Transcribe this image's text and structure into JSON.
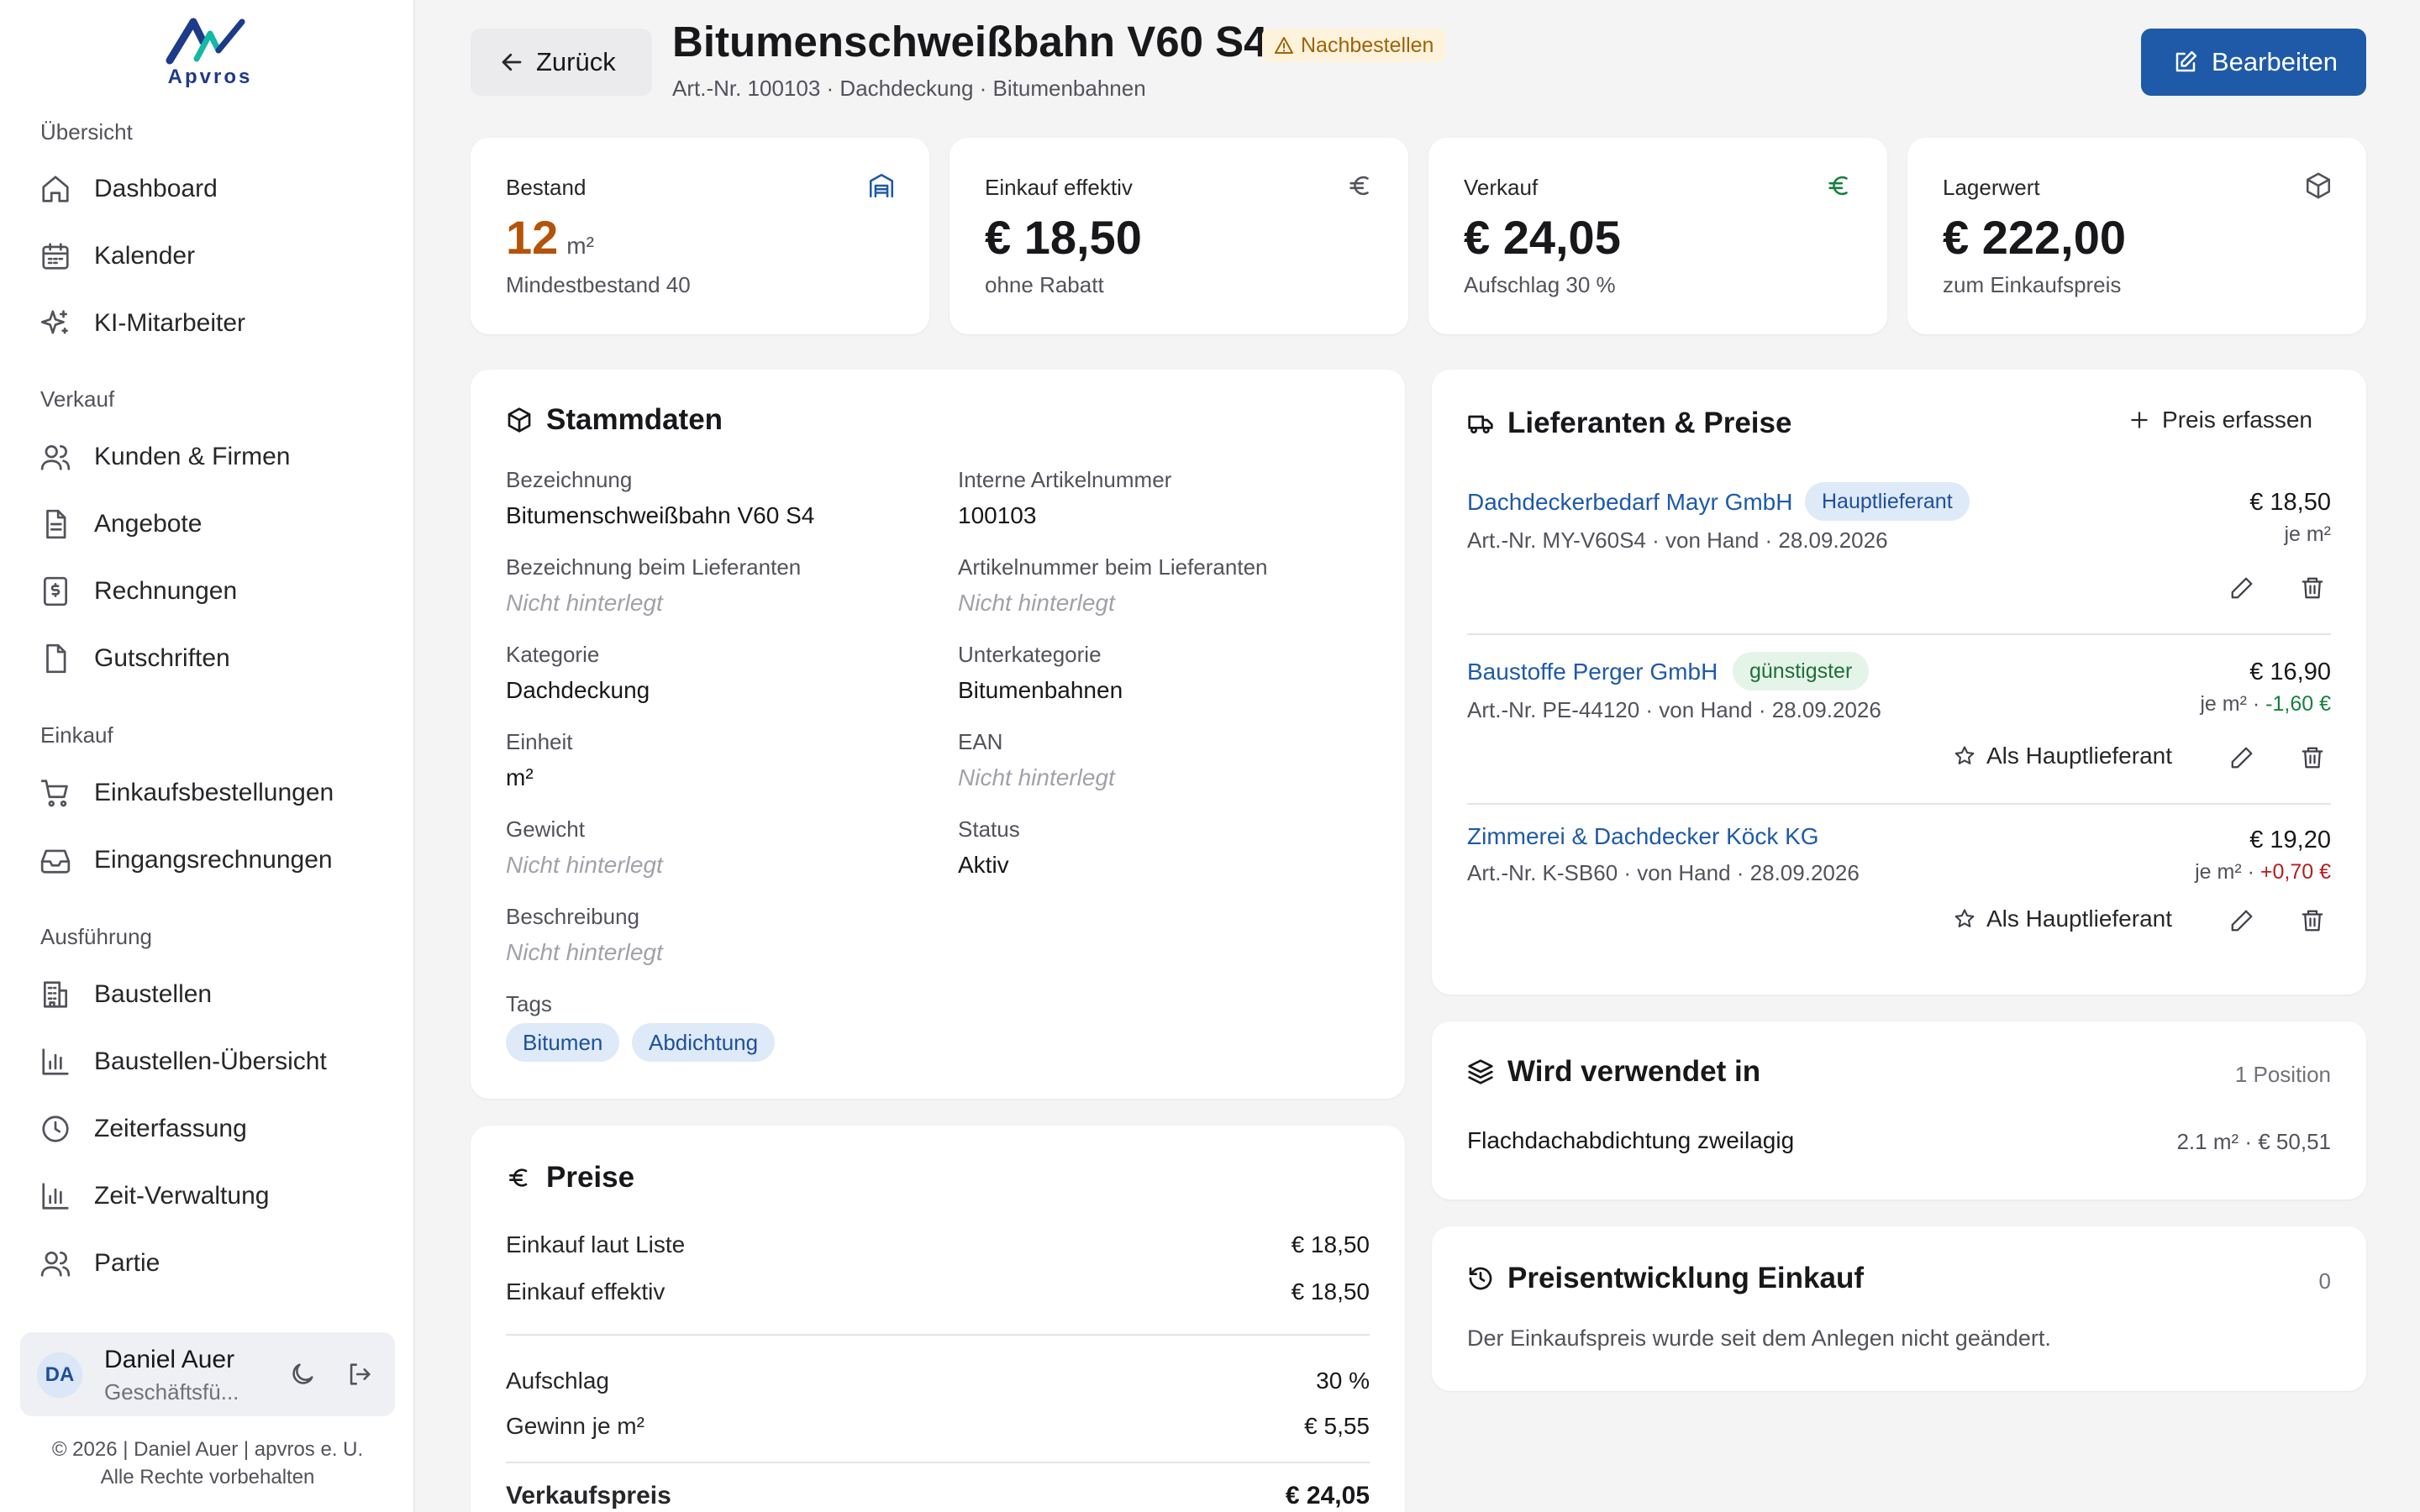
{
  "brand": {
    "logo_text": "Apvros",
    "accent": "#1e5aa8",
    "logo_colors": [
      "#1e3a8a",
      "#14b8a6"
    ]
  },
  "sidebar": {
    "groups": [
      {
        "label": "Übersicht",
        "items": [
          {
            "label": "Dashboard",
            "icon": "home-icon"
          },
          {
            "label": "Kalender",
            "icon": "calendar-icon"
          },
          {
            "label": "KI-Mitarbeiter",
            "icon": "sparkles-icon"
          }
        ]
      },
      {
        "label": "Verkauf",
        "items": [
          {
            "label": "Kunden & Firmen",
            "icon": "users-icon"
          },
          {
            "label": "Angebote",
            "icon": "document-icon"
          },
          {
            "label": "Rechnungen",
            "icon": "invoice-icon"
          },
          {
            "label": "Gutschriften",
            "icon": "file-icon"
          }
        ]
      },
      {
        "label": "Einkauf",
        "items": [
          {
            "label": "Einkaufsbestellungen",
            "icon": "cart-icon"
          },
          {
            "label": "Eingangsrechnungen",
            "icon": "inbox-icon"
          }
        ]
      },
      {
        "label": "Ausführung",
        "items": [
          {
            "label": "Baustellen",
            "icon": "building-icon"
          },
          {
            "label": "Baustellen-Übersicht",
            "icon": "bar-chart-icon"
          },
          {
            "label": "Zeiterfassung",
            "icon": "clock-icon"
          },
          {
            "label": "Zeit-Verwaltung",
            "icon": "bar-chart-icon"
          },
          {
            "label": "Partie",
            "icon": "users-icon"
          }
        ]
      }
    ],
    "user": {
      "initials": "DA",
      "name": "Daniel Auer",
      "role": "Geschäftsfü..."
    },
    "footer": {
      "line1": "© 2026 | Daniel Auer | apvros e. U.",
      "line2": "Alle Rechte vorbehalten"
    }
  },
  "header": {
    "back_label": "Zurück",
    "title": "Bitumenschweißbahn V60 S4",
    "status_badge": "Nachbestellen",
    "subtitle": "Art.-Nr. 100103 · Dachdeckung · Bitumenbahnen",
    "edit_label": "Bearbeiten"
  },
  "stats": [
    {
      "label": "Bestand",
      "value": "12",
      "unit": "m²",
      "sub": "Mindestbestand 40",
      "icon": "warehouse-icon",
      "value_color": "#b45309",
      "icon_color": "#1e5aa8"
    },
    {
      "label": "Einkauf effektiv",
      "value": "€ 18,50",
      "unit": "",
      "sub": "ohne Rabatt",
      "icon": "euro-icon",
      "value_color": "#18181b",
      "icon_color": "#52525b"
    },
    {
      "label": "Verkauf",
      "value": "€ 24,05",
      "unit": "",
      "sub": "Aufschlag 30 %",
      "icon": "euro-icon",
      "value_color": "#18181b",
      "icon_color": "#15803d"
    },
    {
      "label": "Lagerwert",
      "value": "€ 222,00",
      "unit": "",
      "sub": "zum Einkaufspreis",
      "icon": "box-icon",
      "value_color": "#18181b",
      "icon_color": "#52525b"
    }
  ],
  "stammdaten": {
    "title": "Stammdaten",
    "fields": [
      {
        "label": "Bezeichnung",
        "value": "Bitumenschweißbahn V60 S4",
        "empty": false
      },
      {
        "label": "Interne Artikelnummer",
        "value": "100103",
        "empty": false
      },
      {
        "label": "Bezeichnung beim Lieferanten",
        "value": "Nicht hinterlegt",
        "empty": true
      },
      {
        "label": "Artikelnummer beim Lieferanten",
        "value": "Nicht hinterlegt",
        "empty": true
      },
      {
        "label": "Kategorie",
        "value": "Dachdeckung",
        "empty": false
      },
      {
        "label": "Unterkategorie",
        "value": "Bitumenbahnen",
        "empty": false
      },
      {
        "label": "Einheit",
        "value": "m²",
        "empty": false
      },
      {
        "label": "EAN",
        "value": "Nicht hinterlegt",
        "empty": true
      },
      {
        "label": "Gewicht",
        "value": "Nicht hinterlegt",
        "empty": true
      },
      {
        "label": "Status",
        "value": "Aktiv",
        "empty": false
      },
      {
        "label": "Beschreibung",
        "value": "Nicht hinterlegt",
        "empty": true
      }
    ],
    "tags_label": "Tags",
    "tags": [
      "Bitumen",
      "Abdichtung"
    ]
  },
  "preise": {
    "title": "Preise",
    "rows": [
      {
        "label": "Einkauf laut Liste",
        "value": "€ 18,50"
      },
      {
        "label": "Einkauf effektiv",
        "value": "€ 18,50"
      },
      {
        "label": "Aufschlag",
        "value": "30 %"
      },
      {
        "label": "Gewinn je m²",
        "value": "€ 5,55"
      },
      {
        "label": "Verkaufspreis",
        "value": "€ 24,05"
      }
    ]
  },
  "lieferanten": {
    "title": "Lieferanten & Preise",
    "add_label": "Preis erfassen",
    "main_supplier_label": "Als Hauptlieferant",
    "items": [
      {
        "name": "Dachdeckerbedarf Mayr GmbH",
        "badge": "Hauptlieferant",
        "meta": "Art.-Nr. MY-V60S4 · von Hand · 28.09.2026",
        "price": "€ 18,50",
        "unit": "je m²",
        "delta": ""
      },
      {
        "name": "Baustoffe Perger GmbH",
        "badge": "günstigster",
        "meta": "Art.-Nr. PE-44120 · von Hand · 28.09.2026",
        "price": "€ 16,90",
        "unit": "je m² ·",
        "delta": "-1,60 €"
      },
      {
        "name": "Zimmerei & Dachdecker Köck KG",
        "badge": "",
        "meta": "Art.-Nr. K-SB60 · von Hand · 28.09.2026",
        "price": "€ 19,20",
        "unit": "je m² ·",
        "delta": "+0,70 €"
      }
    ]
  },
  "verwendet": {
    "title": "Wird verwendet in",
    "count": "1 Position",
    "items": [
      {
        "name": "Flachdachabdichtung zweilagig",
        "detail": "2.1 m² · € 50,51"
      }
    ]
  },
  "preisentwicklung": {
    "title": "Preisentwicklung Einkauf",
    "count": "0",
    "empty_text": "Der Einkaufspreis wurde seit dem Anlegen nicht geändert."
  }
}
